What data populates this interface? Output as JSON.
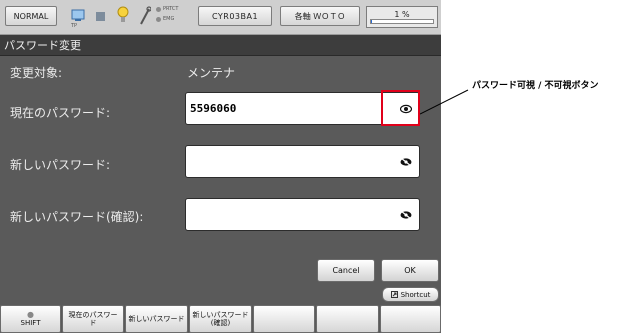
{
  "status_bar": {
    "mode": "NORMAL",
    "tp_label": "TP",
    "lamp_labels": [
      "PRTCT",
      "EMG"
    ],
    "robot": "CYR03BA1",
    "axis": "各軸 ＷＯＴＯ",
    "speed_text": "1 %",
    "speed_percent": 1
  },
  "window": {
    "title": "パスワード変更"
  },
  "form": {
    "target_label": "変更対象:",
    "target_value": "メンテナ",
    "current_label": "現在のパスワード:",
    "current_value": "5596060",
    "new_label": "新しいパスワード:",
    "new_value": "",
    "confirm_label": "新しいパスワード(確認):",
    "confirm_value": ""
  },
  "buttons": {
    "cancel": "Cancel",
    "ok": "OK",
    "shortcut": "Shortcut"
  },
  "fkeys": [
    {
      "line1": "●",
      "line2": "SHIFT"
    },
    {
      "line1": "現在のパスワー",
      "line2": "ド"
    },
    {
      "line1": "新しいパスワード",
      "line2": ""
    },
    {
      "line1": "新しいパスワード",
      "line2": "(確認)"
    },
    {
      "line1": "",
      "line2": ""
    },
    {
      "line1": "",
      "line2": ""
    },
    {
      "line1": "",
      "line2": ""
    }
  ],
  "annotation": {
    "callout": "パスワード可視 / 不可視ボタン",
    "highlight_color": "#e0001a"
  },
  "colors": {
    "screen_bg": "#5a5a5a",
    "title_bg": "#3d3d3d",
    "accent": "#2a6bd2"
  }
}
